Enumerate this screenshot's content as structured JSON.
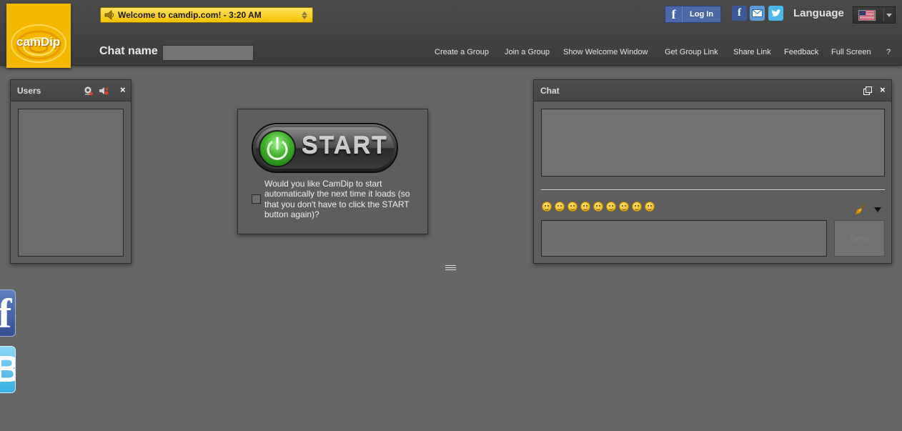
{
  "header": {
    "logo_text": "camDip",
    "ticker": "Welcome to camdip.com! - 3:20 AM",
    "chat_name_label": "Chat name",
    "chat_name_value": "",
    "login_label": "Log In",
    "language_label": "Language",
    "language_selected": "en-US"
  },
  "nav": {
    "items": [
      "Create a Group",
      "Join a Group",
      "Show Welcome Window",
      "Get Group Link",
      "Share Link",
      "Feedback",
      "Full Screen",
      "?"
    ]
  },
  "users_panel": {
    "title": "Users",
    "close": "×"
  },
  "chat_panel": {
    "title": "Chat",
    "close": "×",
    "send_label": "Send",
    "emoji_count": 9
  },
  "start_panel": {
    "button_label": "START",
    "auto_start_text": "Would you like CamDip to start automatically the next time it loads (so that you don't have to click the START button again)?",
    "auto_start_checked": false
  },
  "side_social": {
    "facebook_glyph": "f",
    "twitter_glyph": "B"
  },
  "colors": {
    "background": "#666666",
    "accent": "#f5b800",
    "facebook": "#3b5998",
    "twitter": "#4db6e8"
  },
  "icons": {
    "ticker": "megaphone-icon",
    "users_header": [
      "webcam-icon",
      "speaker-mute-icon"
    ],
    "chat_header": [
      "popout-icon"
    ],
    "chat_tools": [
      "broom-icon",
      "caret-down-icon"
    ]
  }
}
